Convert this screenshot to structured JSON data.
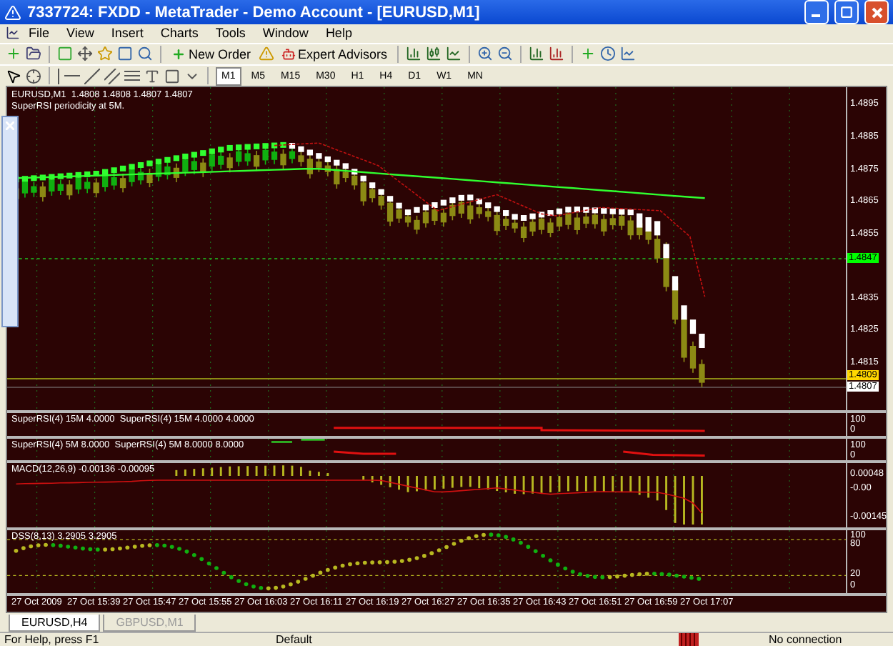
{
  "window": {
    "title": "7337724: FXDD - MetaTrader - Demo Account - [EURUSD,M1]"
  },
  "menu": [
    "File",
    "View",
    "Insert",
    "Charts",
    "Tools",
    "Window",
    "Help"
  ],
  "toolbar": {
    "new_order": "New Order",
    "expert_advisors": "Expert Advisors"
  },
  "timeframes": [
    {
      "label": "M1",
      "selected": true
    },
    {
      "label": "M5",
      "selected": false
    },
    {
      "label": "M15",
      "selected": false
    },
    {
      "label": "M30",
      "selected": false
    },
    {
      "label": "H1",
      "selected": false
    },
    {
      "label": "H4",
      "selected": false
    },
    {
      "label": "D1",
      "selected": false
    },
    {
      "label": "W1",
      "selected": false
    },
    {
      "label": "MN",
      "selected": false
    }
  ],
  "chart": {
    "legend": [
      "EURUSD,M1  1.4808 1.4808 1.4807 1.4807",
      "SuperRSI periodicity at 5M."
    ],
    "price_axis": [
      "1.4895",
      "1.4885",
      "1.4875",
      "1.4865",
      "1.4855",
      "1.4835",
      "1.4825",
      "1.4815"
    ],
    "price_tags": [
      {
        "text": "1.4847",
        "color": "#00ff00"
      },
      {
        "text": "1.4809",
        "color": "#ffd700"
      },
      {
        "text": "1.4807",
        "color": "#ffffff"
      }
    ]
  },
  "indicators": [
    {
      "kind": "rsi",
      "label": "SuperRSI(4) 15M 4.0000  SuperRSI(4) 15M 4.0000 4.0000",
      "axis": [
        "100",
        "0"
      ]
    },
    {
      "kind": "rsi2",
      "label": "SuperRSI(4) 5M 8.0000  SuperRSI(4) 5M 8.0000 8.0000",
      "axis": [
        "100",
        "0"
      ]
    },
    {
      "kind": "macd",
      "label": "MACD(12,26,9) -0.00136 -0.00095",
      "axis": [
        "0.00048",
        "-0.00",
        "-0.00145"
      ]
    },
    {
      "kind": "dss",
      "label": "DSS(8,13) 3.2905 3.2905",
      "axis": [
        "100",
        "80",
        "20",
        "0"
      ]
    }
  ],
  "time_axis": [
    "27 Oct 2009",
    "27 Oct 15:39",
    "27 Oct 15:47",
    "27 Oct 15:55",
    "27 Oct 16:03",
    "27 Oct 16:11",
    "27 Oct 16:19",
    "27 Oct 16:27",
    "27 Oct 16:35",
    "27 Oct 16:43",
    "27 Oct 16:51",
    "27 Oct 16:59",
    "27 Oct 17:07"
  ],
  "tabs": [
    {
      "label": "EURUSD,H4",
      "selected": true
    },
    {
      "label": "GBPUSD,M1",
      "selected": false
    }
  ],
  "status_bar": {
    "help": "For Help, press F1",
    "profile": "Default",
    "connection": "No connection"
  }
}
